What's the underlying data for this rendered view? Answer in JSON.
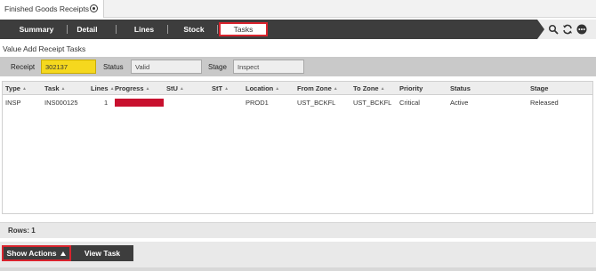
{
  "doc_tab": {
    "title": "Finished Goods Receipts"
  },
  "nav": {
    "tabs": [
      {
        "label": "Summary"
      },
      {
        "label": "Detail"
      },
      {
        "label": "Lines"
      },
      {
        "label": "Stock"
      },
      {
        "label": "Tasks",
        "active": true
      }
    ],
    "tools": [
      "search-icon",
      "refresh-icon",
      "more-icon"
    ]
  },
  "section": {
    "title": "Value Add Receipt Tasks"
  },
  "filters": {
    "receipt_label": "Receipt",
    "receipt_value": "302137",
    "status_label": "Status",
    "status_value": "Valid",
    "stage_label": "Stage",
    "stage_value": "Inspect"
  },
  "grid": {
    "columns": [
      "Type",
      "Task",
      "Lines",
      "Progress",
      "StU",
      "StT",
      "Location",
      "From Zone",
      "To Zone",
      "Priority",
      "Status",
      "Stage"
    ],
    "rows": [
      {
        "type": "INSP",
        "task": "INS000125",
        "lines": "1",
        "progress": 1.0,
        "stu": "",
        "stt": "",
        "location": "PROD1",
        "from_zone": "UST_BCKFL",
        "to_zone": "UST_BCKFL",
        "priority": "Critical",
        "status": "Active",
        "stage": "Released"
      }
    ]
  },
  "footer": {
    "rows_text": "Rows: 1"
  },
  "actions": {
    "show_actions": "Show Actions",
    "view_task": "View Task"
  },
  "colors": {
    "accent_red": "#d9232d",
    "progress_red": "#c8102e",
    "highlight_yellow": "#f5d81e",
    "dark_bar": "#3d3d3d"
  }
}
